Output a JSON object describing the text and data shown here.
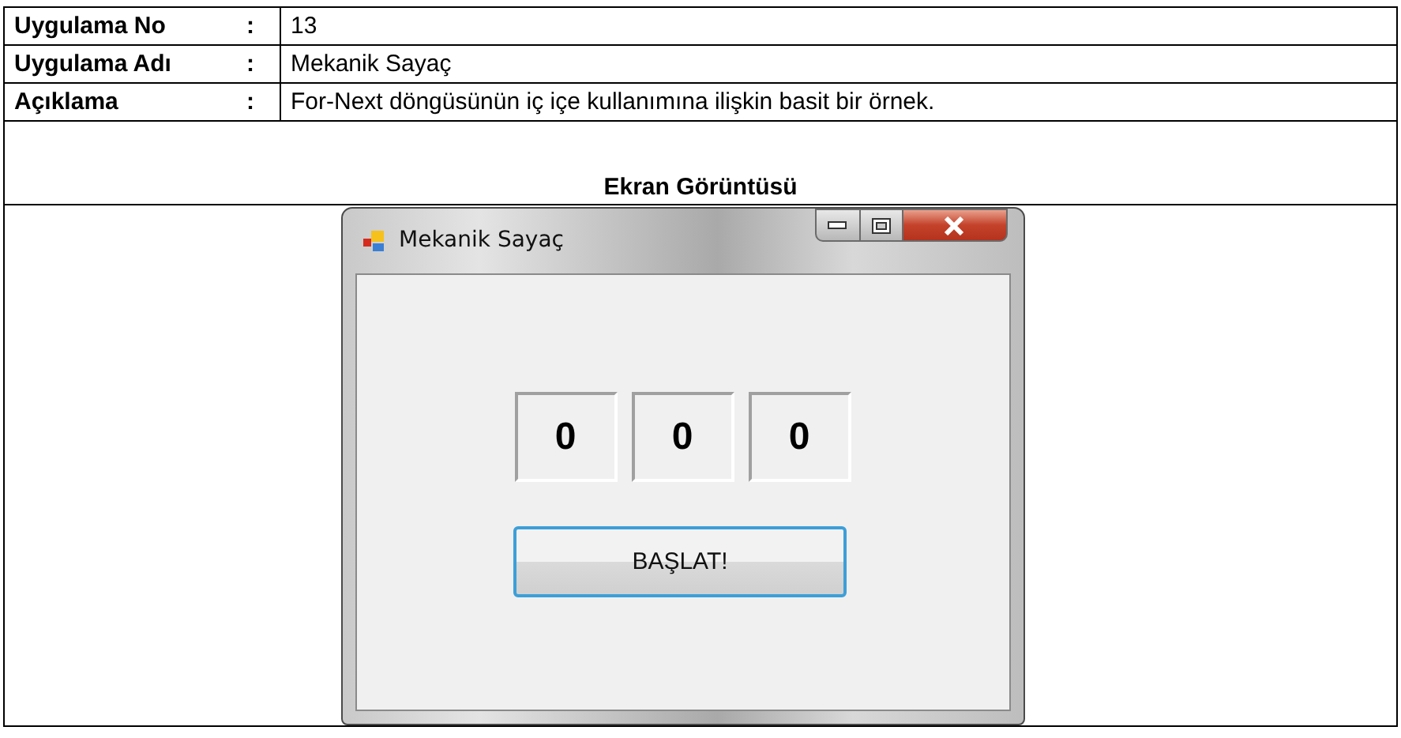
{
  "document": {
    "rows": [
      {
        "label": "Uygulama No",
        "separator": ":",
        "value": "13"
      },
      {
        "label": "Uygulama Adı",
        "separator": ":",
        "value": "Mekanik Sayaç"
      },
      {
        "label": "Açıklama",
        "separator": ":",
        "value": "For-Next döngüsünün iç içe kullanımına ilişkin basit bir örnek."
      }
    ],
    "section_title": "Ekran Görüntüsü"
  },
  "window": {
    "title": "Mekanik Sayaç",
    "counters": [
      "0",
      "0",
      "0"
    ],
    "button": "BAŞLAT!"
  }
}
